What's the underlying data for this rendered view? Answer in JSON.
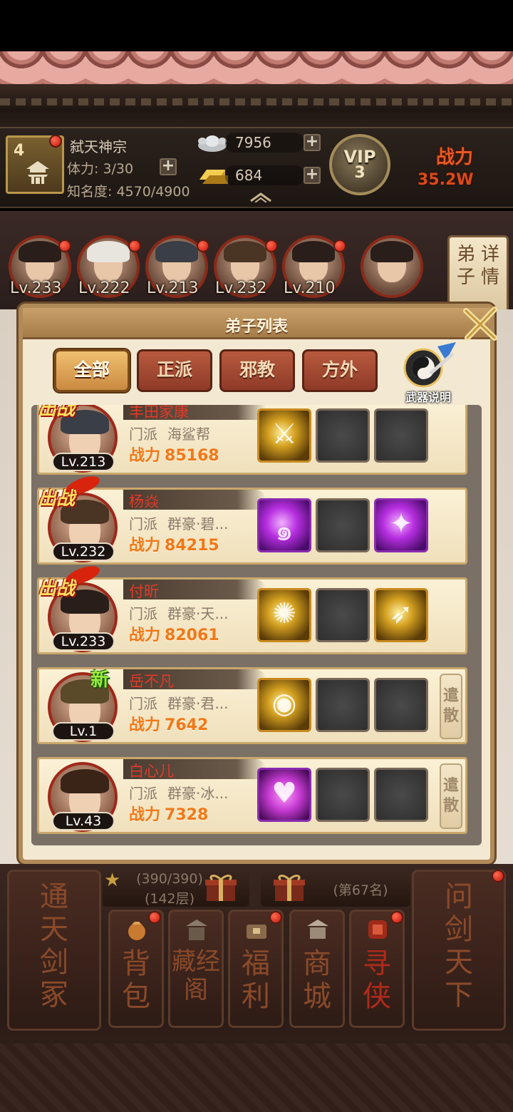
{
  "header": {
    "guild_level": "4",
    "guild_name": "弑天神宗",
    "stamina": "体力: 3/30",
    "fame": "知名度: 4570/4900",
    "silver": "7956",
    "gold": "684",
    "vip_label": "VIP",
    "vip_level": "3",
    "power_label": "战力",
    "power_value": "35.2W"
  },
  "hero_strip": {
    "levels": [
      "Lv.233",
      "Lv.222",
      "Lv.213",
      "Lv.232",
      "Lv.210"
    ],
    "detail_button": [
      "弟子",
      "详情"
    ]
  },
  "modal": {
    "title": "弟子列表",
    "tabs": [
      "全部",
      "正派",
      "邪教",
      "方外"
    ],
    "active_tab": "全部",
    "weapon_help_label": "武器说明",
    "battle_tag": "出战",
    "new_tag": "新",
    "dismiss_label": "遣散",
    "sect_key": "门派",
    "power_key": "战力",
    "disciples": [
      {
        "name": "丰田家康",
        "level": "Lv.213",
        "sect": "海鲨帮",
        "power": "85168",
        "in_battle": true,
        "is_new": false,
        "dismissable": false,
        "slots": [
          "gold",
          "empty",
          "empty"
        ]
      },
      {
        "name": "杨焱",
        "level": "Lv.232",
        "sect": "群豪·碧...",
        "power": "84215",
        "in_battle": true,
        "is_new": false,
        "dismissable": false,
        "slots": [
          "purple",
          "empty",
          "purple"
        ]
      },
      {
        "name": "付昕",
        "level": "Lv.233",
        "sect": "群豪·天...",
        "power": "82061",
        "in_battle": true,
        "is_new": false,
        "dismissable": false,
        "slots": [
          "gold",
          "empty",
          "gold"
        ]
      },
      {
        "name": "岳不凡",
        "level": "Lv.1",
        "sect": "群豪·君...",
        "power": "7642",
        "in_battle": false,
        "is_new": true,
        "dismissable": true,
        "slots": [
          "gold",
          "empty",
          "empty"
        ]
      },
      {
        "name": "白心儿",
        "level": "Lv.43",
        "sect": "群豪·冰...",
        "power": "7328",
        "in_battle": false,
        "is_new": false,
        "dismissable": true,
        "slots": [
          "heart",
          "empty",
          "empty"
        ]
      }
    ]
  },
  "bottom": {
    "left_tall": "通天剑冢",
    "right_tall": "问剑天下",
    "tower_progress": "(390/390)",
    "tower_floor": "(142层)",
    "rank": "(第67名)",
    "nav": [
      "背包",
      "藏经阁",
      "福利",
      "商城",
      "寻侠"
    ]
  },
  "colors": {
    "accent_red": "#e23a2a",
    "power_orange": "#f07818",
    "tab_active": "#f0c070",
    "tab_inactive": "#b85a3e"
  }
}
